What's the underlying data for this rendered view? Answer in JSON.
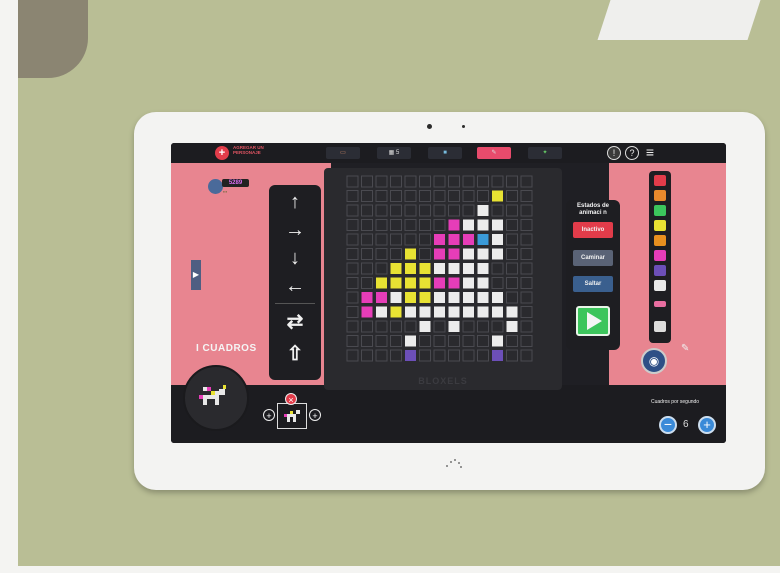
{
  "top_bar": {
    "add_button_symbol": "+",
    "add_character_label": "AGREGAR UN PERSONAJE",
    "tabs": [
      {
        "name": "tab-scenes",
        "label": ""
      },
      {
        "name": "tab-characters",
        "label": "5"
      },
      {
        "name": "tab-backgrounds",
        "label": ""
      },
      {
        "name": "tab-editor",
        "label": ""
      },
      {
        "name": "tab-effects",
        "label": ""
      }
    ],
    "help_symbol": "?",
    "menu_symbol": "≡"
  },
  "player": {
    "score": "5289"
  },
  "direction_buttons": [
    "↑",
    "→",
    "↓",
    "←",
    "⇄",
    "⇧"
  ],
  "canvas": {
    "brand": "BLOXELS"
  },
  "animation_states": {
    "title": "Estados de animaci n",
    "states": [
      {
        "label": "Inactivo",
        "color": "#e23c4a"
      },
      {
        "label": "Caminar",
        "color": "#5a6376"
      },
      {
        "label": "Saltar",
        "color": "#3a5f8e"
      }
    ]
  },
  "palette": {
    "colors": [
      "#e23c4a",
      "#e88a2c",
      "#3cc55c",
      "#e8e233",
      "#e8901f",
      "#e63db8",
      "#6c4fb8",
      "#e8e8e8",
      "#222222"
    ]
  },
  "frames": {
    "count_label": "I CUADROS",
    "remove_symbol": "×",
    "add_left": "+",
    "add_right": "+"
  },
  "fps": {
    "label": "Cuadros por segundo",
    "value": "6",
    "minus": "−",
    "plus": "+"
  }
}
